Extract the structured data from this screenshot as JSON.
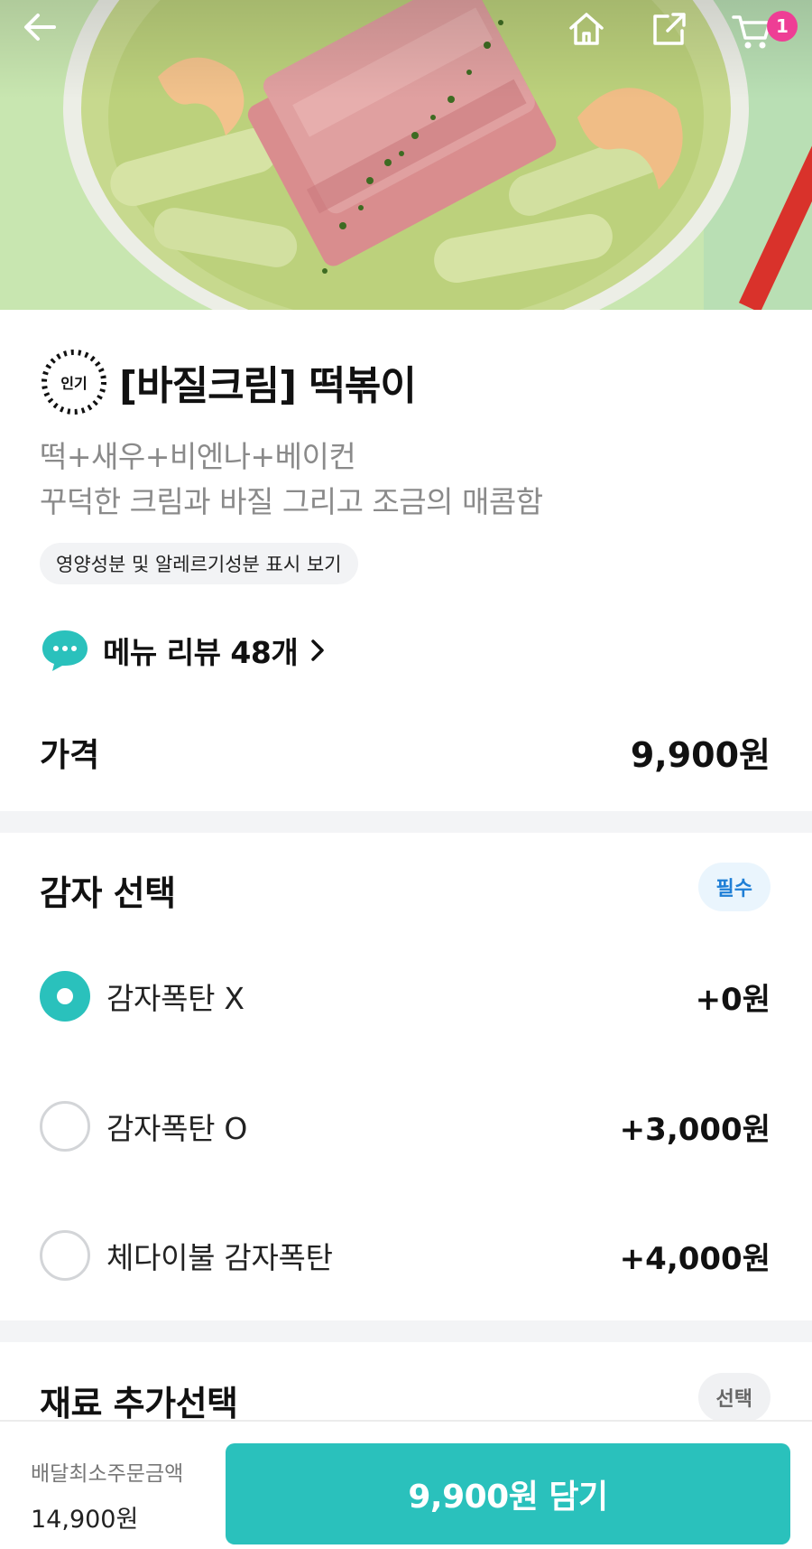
{
  "header": {
    "back_icon": "arrow-left-icon",
    "home_icon": "home-icon",
    "share_icon": "share-icon",
    "cart_icon": "cart-icon",
    "cart_count": "1"
  },
  "menu": {
    "badge": "인기",
    "title": "[바질크림] 떡볶이",
    "description_line1": "떡+새우+비엔나+베이컨",
    "description_line2": "꾸덕한 크림과 바질 그리고 조금의 매콤함",
    "nutrition_link": "영양성분 및 알레르기성분 표시 보기",
    "review_link": "메뉴 리뷰 48개",
    "price_label": "가격",
    "price_value": "9,900원"
  },
  "potato_group": {
    "title": "감자 선택",
    "tag": "필수",
    "options": [
      {
        "name": "감자폭탄 X",
        "price": "+0원",
        "selected": true
      },
      {
        "name": "감자폭탄 O",
        "price": "+3,000원",
        "selected": false
      },
      {
        "name": "체다이불 감자폭탄",
        "price": "+4,000원",
        "selected": false
      }
    ]
  },
  "topping_group": {
    "title": "재료 추가선택",
    "tag": "선택"
  },
  "bottom": {
    "min_order_label": "배달최소주문금액",
    "min_order_value": "14,900원",
    "add_button": "9,900원 담기"
  },
  "colors": {
    "accent": "#2ac1bc",
    "badge_pink": "#ee3e95",
    "required_blue": "#1f7fd6"
  }
}
